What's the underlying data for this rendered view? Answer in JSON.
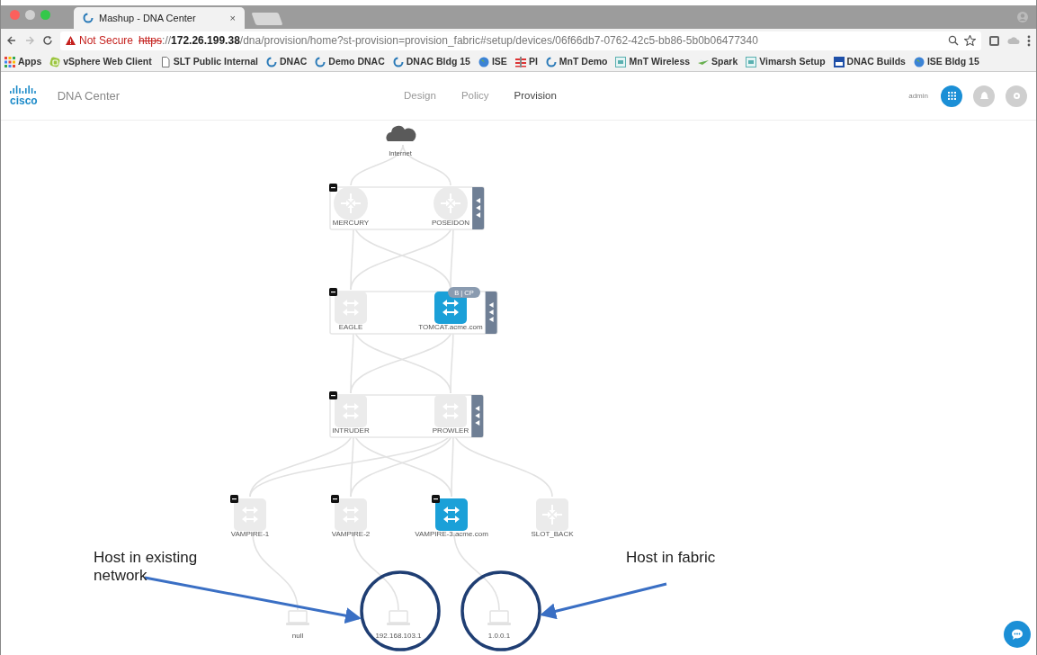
{
  "browser": {
    "tab": {
      "title": "Mashup - DNA Center",
      "close": "×"
    },
    "address": {
      "security": "Not Secure",
      "scheme": "https",
      "separator": "://",
      "host": "172.26.199.38",
      "path": "/dna/provision/home?st-provision=provision_fabric#setup/devices/06f66db7-0762-42c5-bb86-5b0b06477340"
    },
    "bookmarks": [
      {
        "label": "Apps",
        "kind": "grid"
      },
      {
        "label": "vSphere Web Client",
        "kind": "vsphere"
      },
      {
        "label": "SLT Public Internal",
        "kind": "page"
      },
      {
        "label": "DNAC",
        "kind": "ring"
      },
      {
        "label": "Demo DNAC",
        "kind": "ring"
      },
      {
        "label": "DNAC Bldg 15",
        "kind": "ring"
      },
      {
        "label": "ISE",
        "kind": "globe"
      },
      {
        "label": "PI",
        "kind": "flag"
      },
      {
        "label": "MnT Demo",
        "kind": "ring"
      },
      {
        "label": "MnT Wireless",
        "kind": "tile"
      },
      {
        "label": "Spark",
        "kind": "spark"
      },
      {
        "label": "Vimarsh Setup",
        "kind": "tile"
      },
      {
        "label": "DNAC Builds",
        "kind": "builds"
      },
      {
        "label": "ISE Bldg 15",
        "kind": "globe"
      }
    ]
  },
  "app": {
    "brand": "cisco",
    "product": "DNA Center",
    "nav": [
      {
        "label": "Design",
        "selected": false
      },
      {
        "label": "Policy",
        "selected": false
      },
      {
        "label": "Provision",
        "selected": true
      }
    ],
    "user": "admin"
  },
  "topology": {
    "tiers": [
      {
        "nodes": [
          {
            "label": "Internet",
            "kind": "cloud"
          }
        ]
      },
      {
        "grouped": true,
        "nodes": [
          {
            "label": "MERCURY",
            "kind": "router"
          },
          {
            "label": "POSEIDON",
            "kind": "router"
          }
        ]
      },
      {
        "grouped": true,
        "tag": "B | CP",
        "nodes": [
          {
            "label": "EAGLE",
            "kind": "switch"
          },
          {
            "label": "TOMCAT.acme.com",
            "kind": "switch",
            "fabric": true
          }
        ]
      },
      {
        "grouped": true,
        "nodes": [
          {
            "label": "INTRUDER",
            "kind": "switch"
          },
          {
            "label": "PROWLER",
            "kind": "switch"
          }
        ]
      },
      {
        "nodes": [
          {
            "label": "VAMPIRE-1",
            "kind": "switch",
            "badge": true
          },
          {
            "label": "VAMPIRE-2",
            "kind": "switch",
            "badge": true
          },
          {
            "label": "VAMPIRE-3.acme.com",
            "kind": "switch",
            "fabric": true,
            "badge": true
          },
          {
            "label": "SLOT_BACK",
            "kind": "edge"
          }
        ]
      },
      {
        "nodes": [
          {
            "label": "null",
            "kind": "host"
          },
          {
            "label": "192.168.103.1",
            "kind": "host",
            "circled": true
          },
          {
            "label": "1.0.0.1",
            "kind": "host",
            "circled": true
          }
        ]
      }
    ]
  },
  "annotations": [
    {
      "text": "Host in existing network"
    },
    {
      "text": "Host in fabric"
    }
  ]
}
